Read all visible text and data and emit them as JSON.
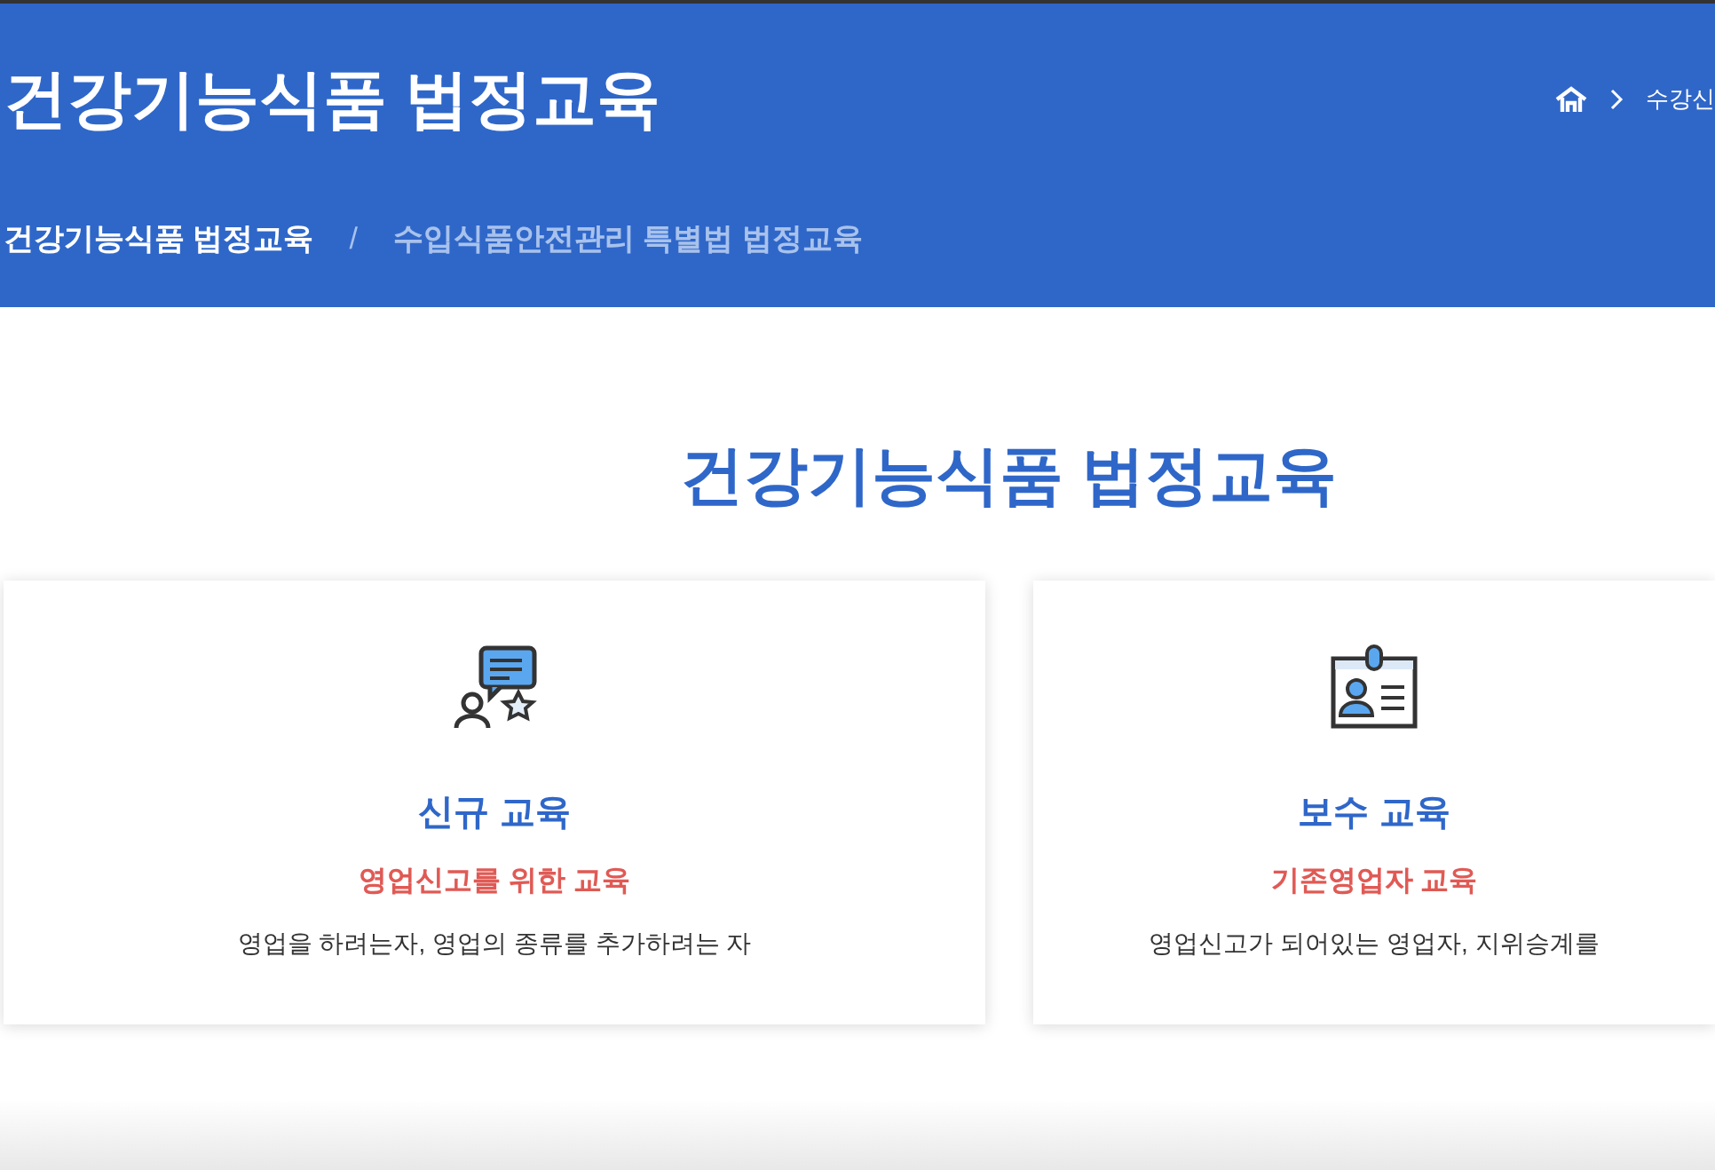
{
  "header": {
    "title": "건강기능식품 법정교육",
    "breadcrumb": {
      "current": "수강신"
    },
    "tabs": [
      {
        "label": "건강기능식품 법정교육",
        "selected": true
      },
      {
        "label": "수입식품안전관리 특별법 법정교육",
        "selected": false
      }
    ],
    "tab_separator": "/"
  },
  "section": {
    "title": "건강기능식품 법정교육",
    "cards": [
      {
        "kind": "review",
        "title": "신규 교육",
        "subtitle": "영업신고를 위한 교육",
        "description": "영업을 하려는자, 영업의 종류를 추가하려는 자"
      },
      {
        "kind": "badge",
        "title": "보수 교육",
        "subtitle": "기존영업자 교육",
        "description": "영업신고가 되어있는 영업자, 지위승계를"
      }
    ]
  }
}
